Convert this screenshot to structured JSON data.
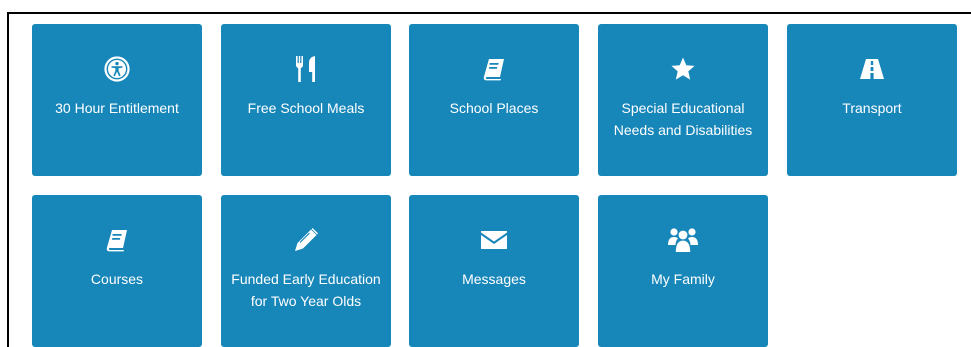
{
  "colors": {
    "tile_background": "#1786b9",
    "tile_text": "#ffffff",
    "frame_border": "#000000"
  },
  "tiles": [
    {
      "label": "30 Hour Entitlement",
      "icon": "accessibility-icon"
    },
    {
      "label": "Free School Meals",
      "icon": "cutlery-icon"
    },
    {
      "label": "School Places",
      "icon": "book-icon"
    },
    {
      "label": "Special Educational Needs and Disabilities",
      "icon": "star-icon"
    },
    {
      "label": "Transport",
      "icon": "road-icon"
    },
    {
      "label": "Courses",
      "icon": "book-icon"
    },
    {
      "label": "Funded Early Education for Two Year Olds",
      "icon": "pencil-icon"
    },
    {
      "label": "Messages",
      "icon": "envelope-icon"
    },
    {
      "label": "My Family",
      "icon": "users-icon"
    }
  ]
}
